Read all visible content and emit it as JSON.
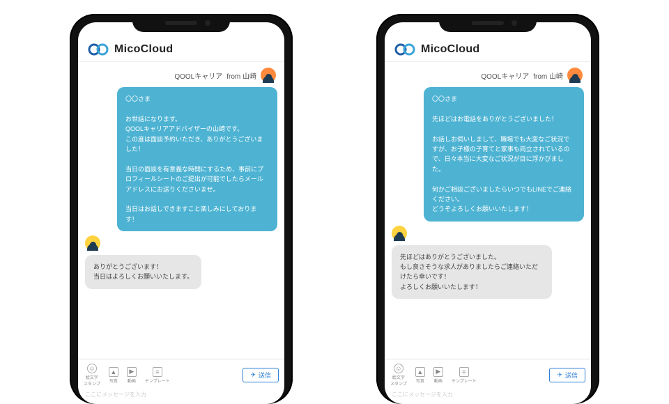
{
  "brand": {
    "name": "MicoCloud"
  },
  "sender": {
    "label_prefix": "QOOLキャリア",
    "label_from": "from 山崎"
  },
  "phones": [
    {
      "incoming": "〇〇さま\n\nお世話になります。\nQOOLキャリアアドバイザーの山崎です。\nこの度は面談予約いただき、ありがとうございました！\n\n当日の面談を有意義な時間にするため、事前にプロフィールシートのご提出が可能でしたらメールアドレスにお送りくださいませ。\n\n当日はお話しできますこと楽しみにしております！",
      "outgoing": "ありがとうございます！\n当日はよろしくお願いいたします。"
    },
    {
      "incoming": "〇〇さま\n\n先ほどはお電話をありがとうございました！\n\nお話しお伺いしまして、職場でも大変なご状況ですが、お子様の子育てと家事も両立されているので、日々本当に大変なご状況が目に浮かびました。\n\n何かご相談ございましたらいつでもLINEでご連絡ください。\nどうぞよろしくお願いいたします！",
      "outgoing": "先ほどはありがとうございました。\nもし良さそうな求人がありましたらご連絡いただけたら幸いです！\nよろしくお願いいたします！"
    }
  ],
  "toolbar": {
    "emoji": "絵文字\nスタンプ",
    "photo": "写真",
    "video": "動画",
    "template": "テンプレート",
    "send": "送信"
  },
  "input": {
    "placeholder": "ここにメッセージを入力"
  }
}
